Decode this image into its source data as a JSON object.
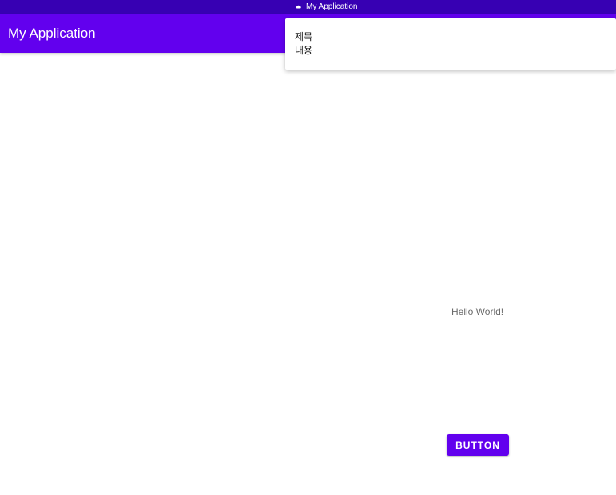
{
  "status_bar": {
    "notification_icon": "cloud-icon",
    "app_name": "My Application"
  },
  "app_bar": {
    "title": "My Application",
    "background_color": "#6200ee"
  },
  "notification": {
    "title": "제목",
    "text": "내용"
  },
  "main": {
    "hello_text": "Hello World!",
    "button_label": "BUTTON"
  },
  "colors": {
    "status_bar": "#3700b3",
    "primary": "#6200ee",
    "button_text": "#ffffff"
  }
}
